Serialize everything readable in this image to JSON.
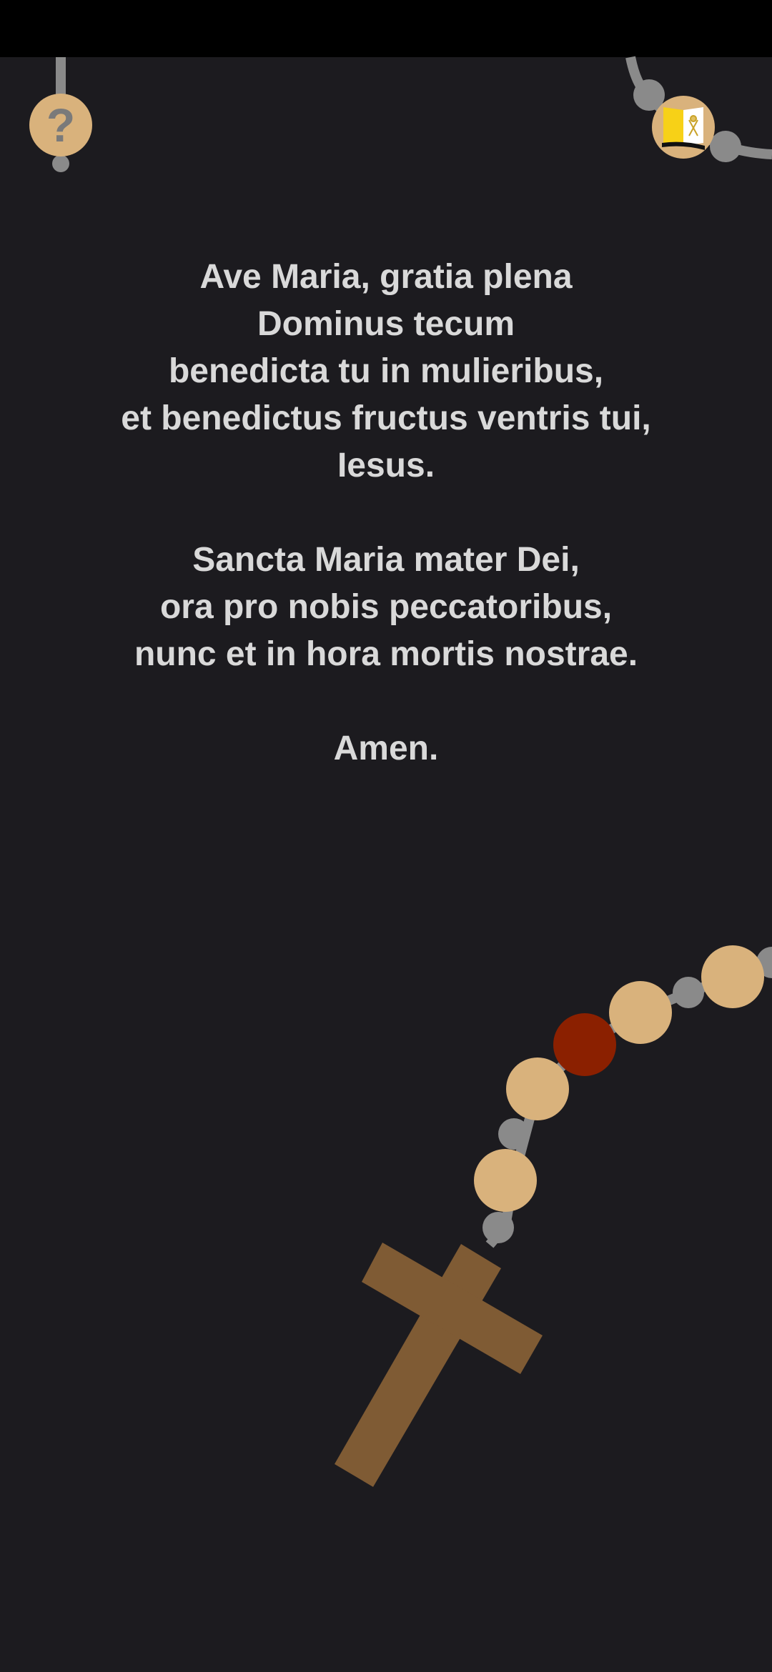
{
  "colors": {
    "background": "#1c1b1f",
    "status_bar": "#000000",
    "text": "#d9d9d9",
    "chain": "#8a8a8a",
    "bead": "#d9b27c",
    "current_bead": "#8b2000",
    "cross": "#7f5b34",
    "flag_yellow": "#f7d117",
    "flag_white": "#ffffff"
  },
  "help_button": {
    "icon": "question-mark-icon",
    "glyph": "?"
  },
  "language_button": {
    "icon": "vatican-flag-icon"
  },
  "prayer": {
    "stanza1": [
      "Ave Maria, gratia plena",
      "Dominus tecum",
      "benedicta tu in mulieribus,",
      "et benedictus fructus ventris tui,",
      "Iesus."
    ],
    "stanza2": [
      "Sancta Maria mater Dei,",
      "ora pro nobis peccatoribus,",
      "nunc et in hora mortis nostrae."
    ],
    "stanza3": [
      "Amen."
    ]
  },
  "rosary": {
    "icon": "rosary-icon",
    "current_bead": "third",
    "cross_icon": "crucifix-icon"
  }
}
